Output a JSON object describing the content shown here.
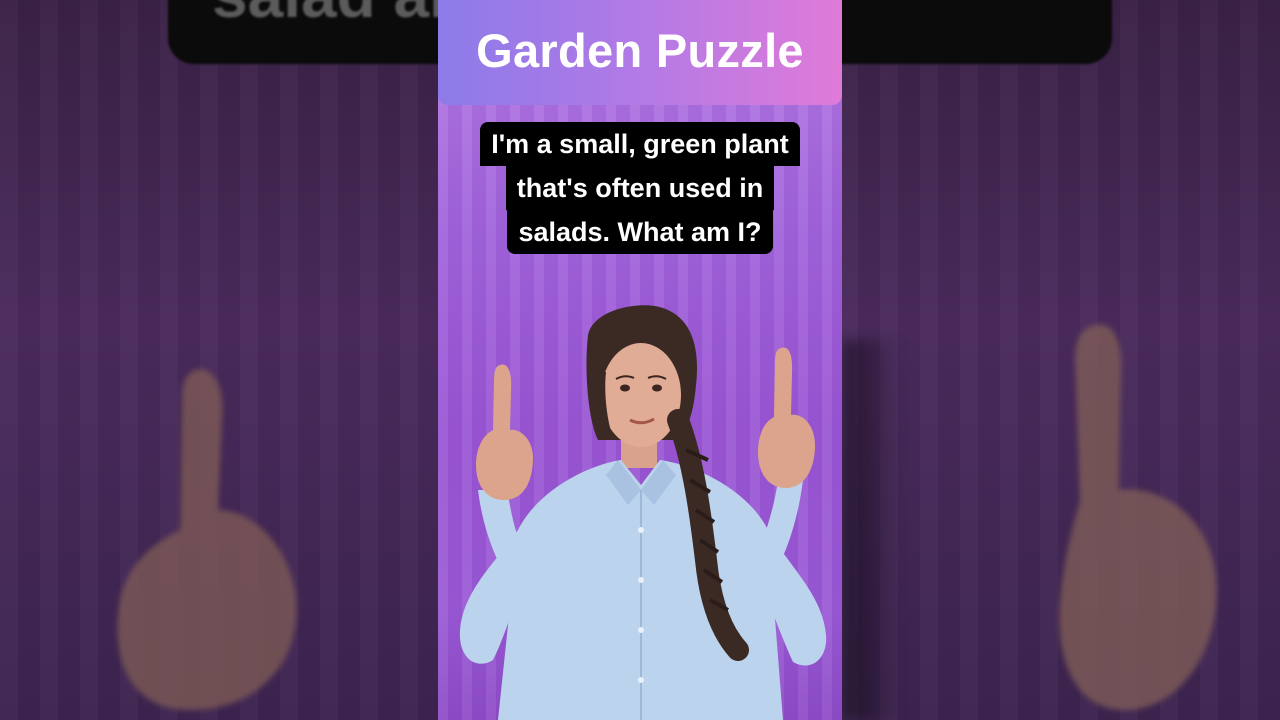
{
  "backdrop": {
    "caption_fragment": "salad                am I?"
  },
  "video": {
    "title": "Garden Puzzle",
    "question_lines": [
      "I'm a small, green plant",
      "that's often used in",
      "salads. What am I?"
    ]
  },
  "colors": {
    "title_gradient_start": "#8c7be8",
    "title_gradient_end": "#e07ad8",
    "background_purple": "#9a56d4",
    "caption_box": "#000000",
    "caption_text": "#ffffff",
    "shirt": "#bcd3ee",
    "hair": "#3b2a24"
  },
  "icons": {
    "presenter": "woman-pointing-up-illustration"
  }
}
